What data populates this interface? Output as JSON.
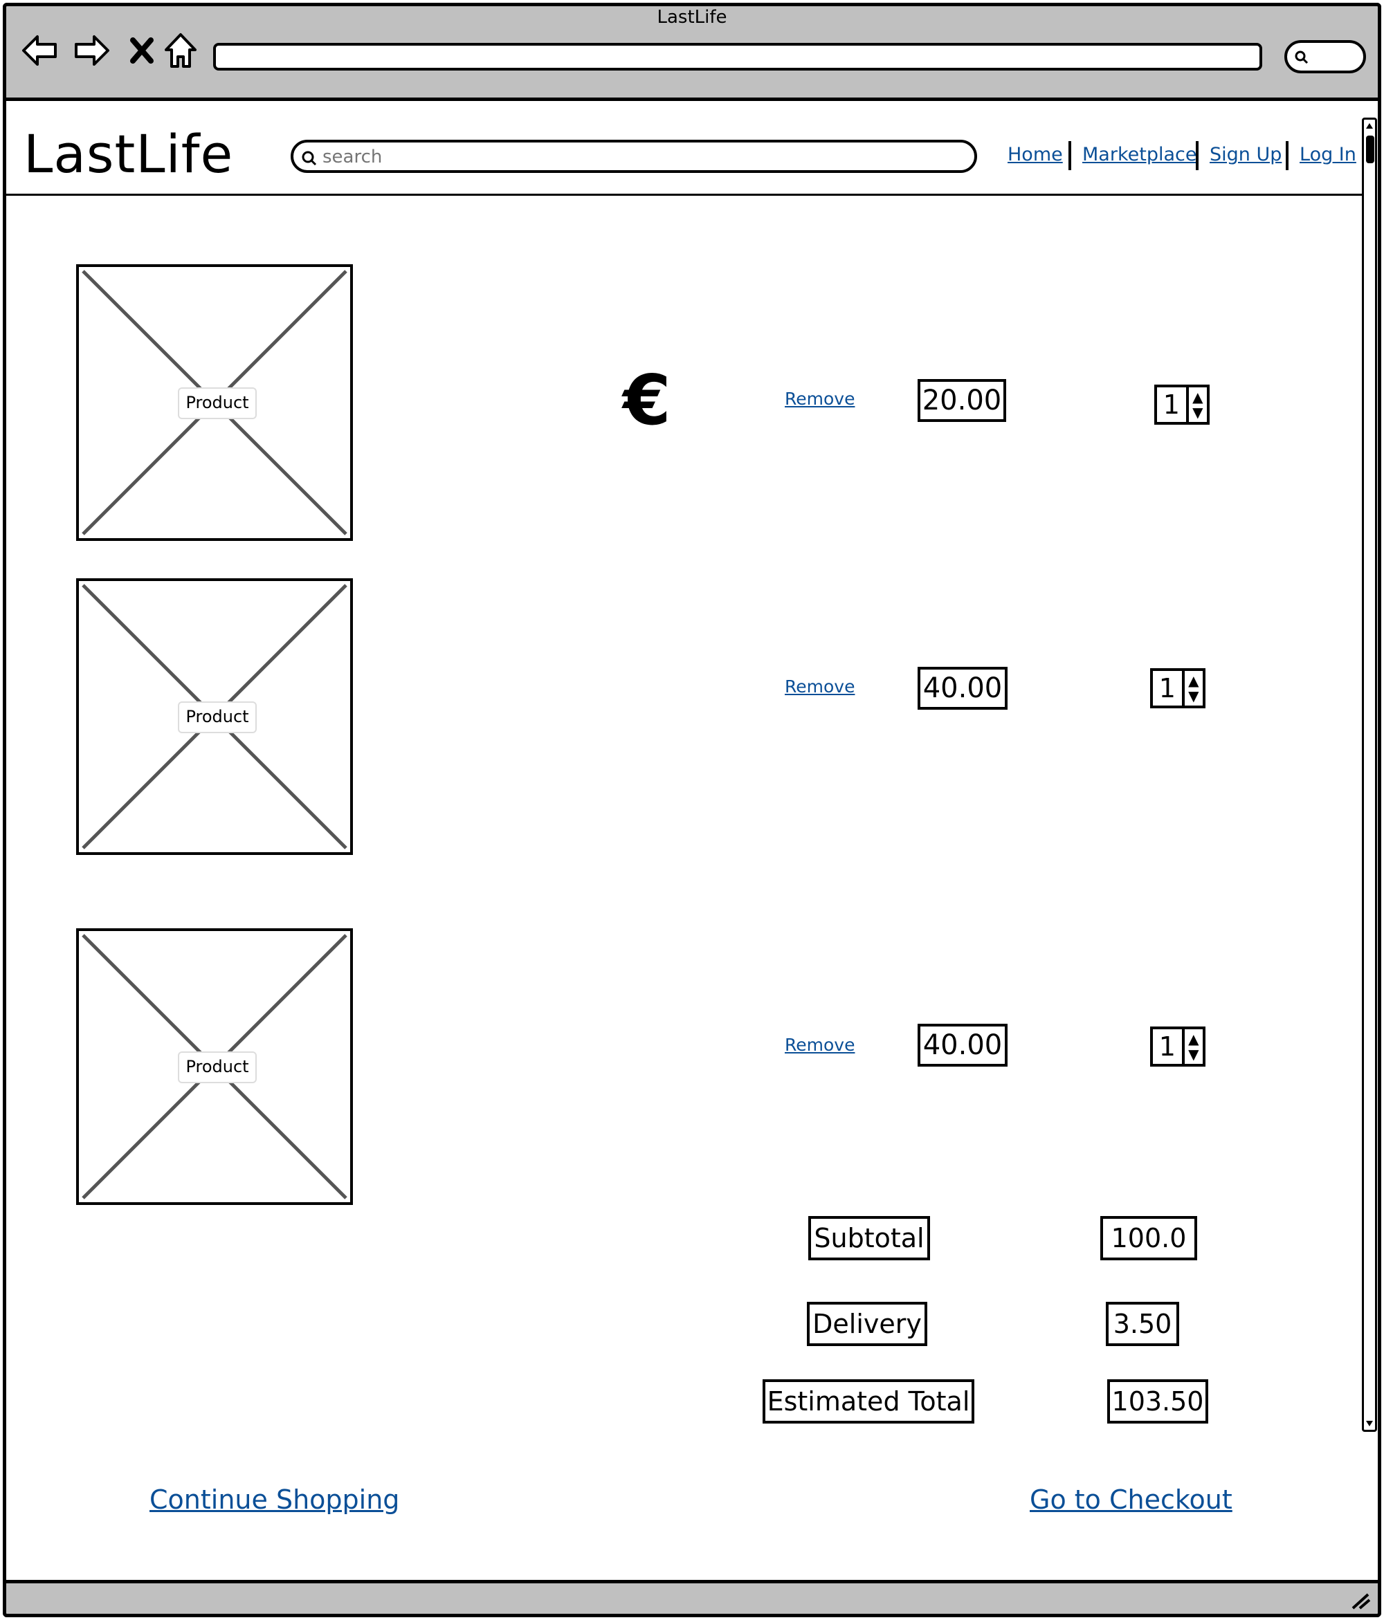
{
  "window": {
    "title": "LastLife"
  },
  "browser": {
    "back_icon": "back-arrow-icon",
    "forward_icon": "forward-arrow-icon",
    "stop_icon": "close-icon",
    "home_icon": "home-icon"
  },
  "header": {
    "logo": "LastLife",
    "search_placeholder": "search",
    "nav": [
      "Home",
      "Marketplace",
      "Sign Up",
      "Log In"
    ]
  },
  "cart": {
    "currency_symbol": "€",
    "items": [
      {
        "image_label": "Product",
        "remove_label": "Remove",
        "price": "20.00",
        "quantity": "1"
      },
      {
        "image_label": "Product",
        "remove_label": "Remove",
        "price": "40.00",
        "quantity": "1"
      },
      {
        "image_label": "Product",
        "remove_label": "Remove",
        "price": "40.00",
        "quantity": "1"
      }
    ],
    "summary": {
      "subtotal_label": "Subtotal",
      "subtotal_value": "100.0",
      "delivery_label": "Delivery",
      "delivery_value": "3.50",
      "total_label": "Estimated Total",
      "total_value": "103.50"
    }
  },
  "actions": {
    "continue_label": "Continue Shopping",
    "checkout_label": "Go to Checkout"
  },
  "colors": {
    "link": "#0b4f97",
    "chrome": "#c0c0c0"
  }
}
